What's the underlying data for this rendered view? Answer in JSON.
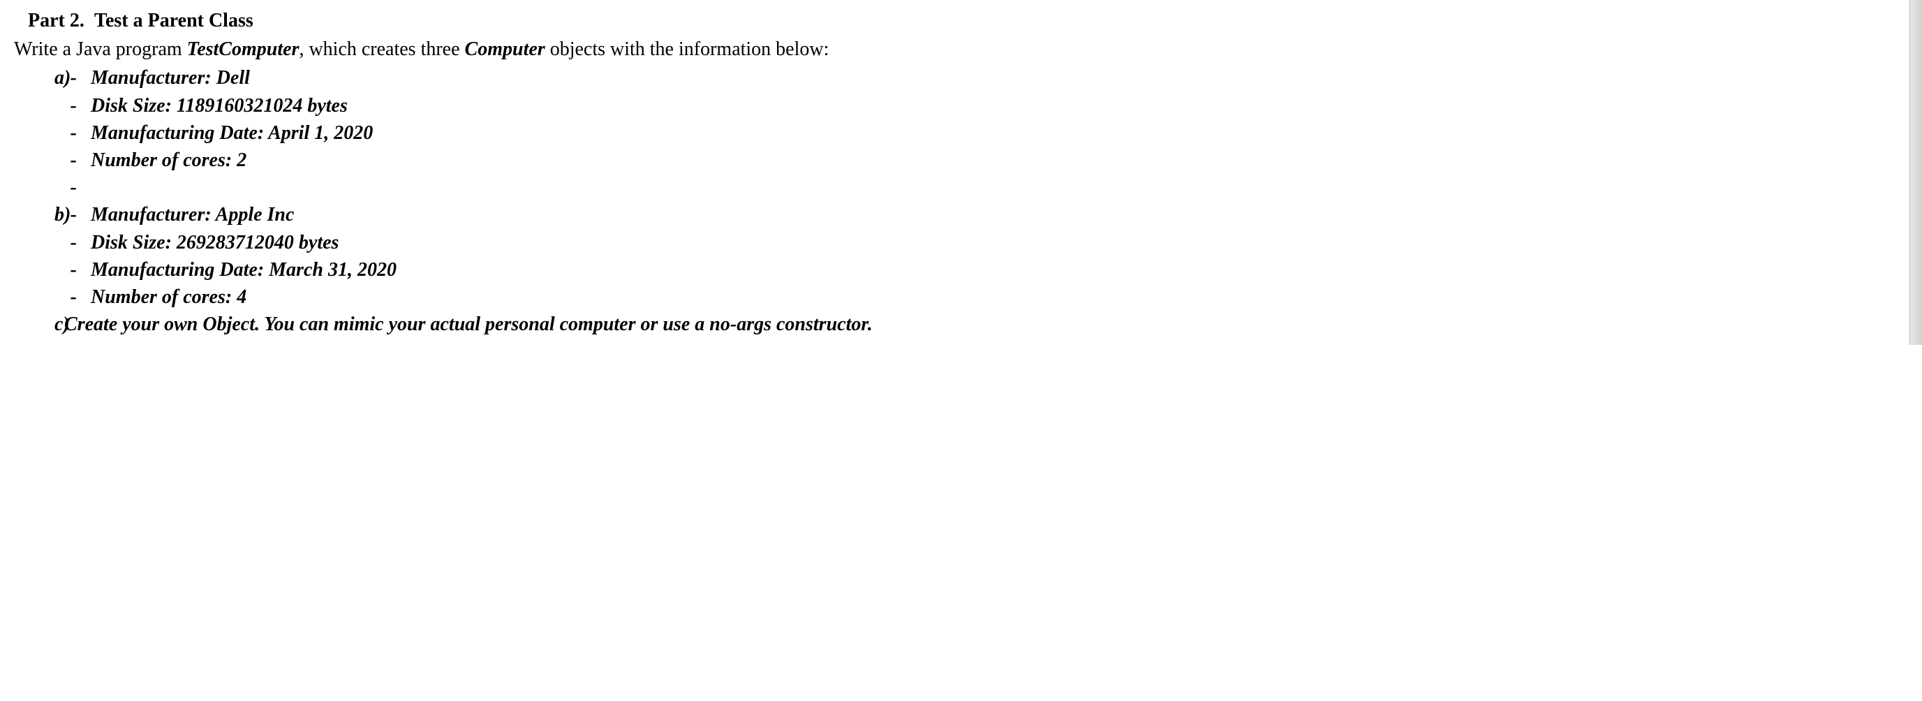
{
  "heading": {
    "part_label": "Part 2.",
    "part_title": "Test a Parent Class"
  },
  "intro": {
    "prefix": "Write a Java program ",
    "program_name": "TestComputer",
    "mid": ", which creates three ",
    "class_name": "Computer",
    "suffix": " objects with the information below:"
  },
  "items": {
    "a": {
      "marker": "a)",
      "bullets": [
        "Manufacturer: Dell",
        "Disk Size: 1189160321024 bytes",
        "Manufacturing Date: April 1, 2020",
        "Number of cores: 2"
      ]
    },
    "b": {
      "marker": "b)",
      "bullets": [
        "Manufacturer: Apple Inc",
        "Disk Size: 269283712040 bytes",
        "Manufacturing Date: March 31, 2020",
        "Number of cores: 4"
      ]
    },
    "c": {
      "marker": "c)",
      "text": "Create your own Object. You can mimic your actual personal computer or use a no-args constructor."
    }
  },
  "dash": "-"
}
